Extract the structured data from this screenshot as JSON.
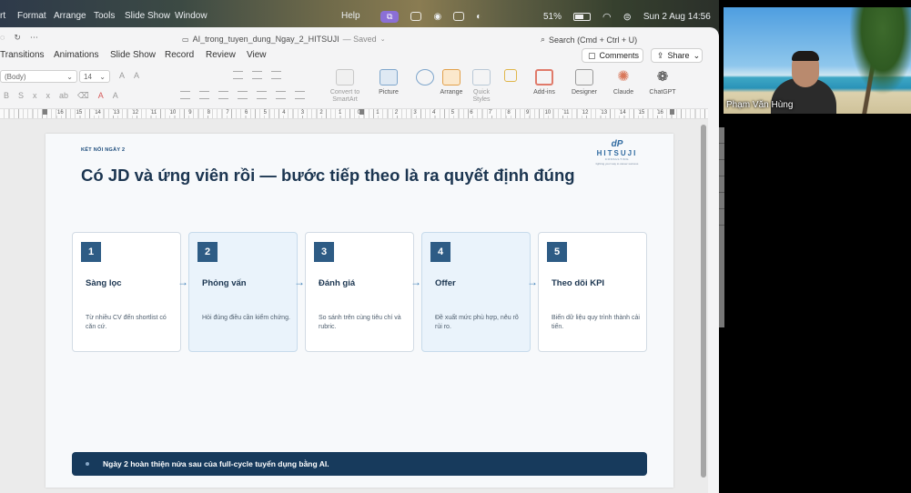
{
  "menubar": {
    "items": [
      "rt",
      "Format",
      "Arrange",
      "Tools",
      "Slide Show",
      "Window"
    ],
    "help": "Help",
    "battery": "51%",
    "datetime": "Sun 2 Aug  14:56"
  },
  "titlebar": {
    "doc_name": "AI_trong_tuyen_dung_Ngay_2_HITSUJI",
    "saved": "— Saved",
    "search_placeholder": "Search (Cmd + Ctrl + U)"
  },
  "tabs": [
    "Transitions",
    "Animations",
    "Slide Show",
    "Record",
    "Review",
    "View"
  ],
  "actions": {
    "comments": "Comments",
    "share": "Share"
  },
  "ribbon": {
    "font": "(Body)",
    "size": "14",
    "convert_smartart": "Convert to SmartArt",
    "picture": "Picture",
    "arrange": "Arrange",
    "quick_styles": "Quick Styles",
    "add_ins": "Add-ins",
    "designer": "Designer",
    "claude": "Claude",
    "chatgpt": "ChatGPT"
  },
  "ruler": [
    "16",
    "15",
    "14",
    "13",
    "12",
    "11",
    "10",
    "9",
    "8",
    "7",
    "6",
    "5",
    "4",
    "3",
    "2",
    "1",
    "0",
    "1",
    "2",
    "3",
    "4",
    "5",
    "6",
    "7",
    "8",
    "9",
    "10",
    "11",
    "12",
    "13",
    "14",
    "15",
    "16"
  ],
  "slide": {
    "kicker": "KẾT NỐI NGÀY 2",
    "title": "Có JD và ứng viên rồi — bước tiếp theo là ra quyết định đúng",
    "logo": {
      "mark": "dP",
      "brand": "HITSUJI",
      "sub": "CONSULTING",
      "tag": "lighting your way to career success"
    },
    "arrow_glyph": "→",
    "steps": [
      {
        "num": "1",
        "title": "Sàng lọc",
        "desc": "Từ nhiều CV đến shortlist có căn cứ."
      },
      {
        "num": "2",
        "title": "Phỏng vấn",
        "desc": "Hỏi đúng điều cần kiểm chứng."
      },
      {
        "num": "3",
        "title": "Đánh giá",
        "desc": "So sánh trên cùng tiêu chí và rubric."
      },
      {
        "num": "4",
        "title": "Offer",
        "desc": "Đề xuất mức phù hợp, nêu rõ rủi ro."
      },
      {
        "num": "5",
        "title": "Theo dõi KPI",
        "desc": "Biến dữ liệu quy trình thành cải tiến."
      }
    ],
    "footer": "Ngày 2 hoàn thiện nửa sau của full-cycle tuyển dụng bằng AI."
  },
  "video": {
    "participant_name": "Phạm Văn Hùng"
  }
}
